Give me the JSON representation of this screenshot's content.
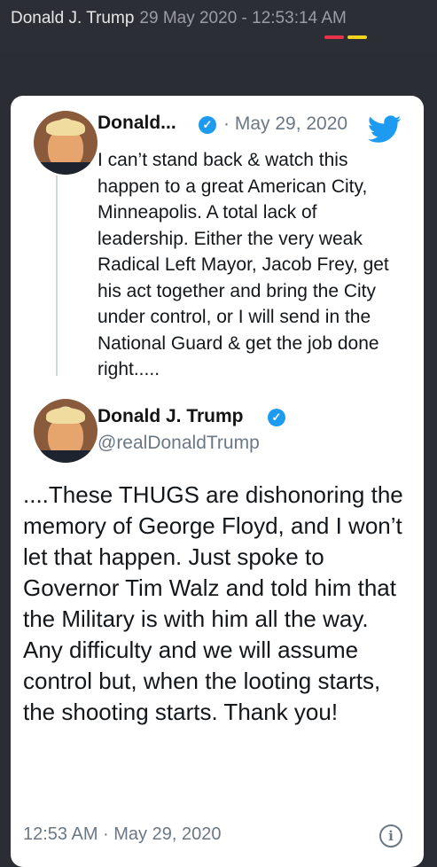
{
  "header": {
    "author": "Donald J. Trump",
    "timestamp": "29 May 2020 - 12:53:14 AM"
  },
  "quoted_tweet": {
    "name": "Donald...",
    "date": "· May 29, 2020",
    "text": "I can’t stand back & watch this happen to a great American City, Minneapolis. A total lack of leadership. Either the very weak Radical Left Mayor, Jacob Frey, get his act together and bring the City under control, or I will send in the National Guard & get the job done right....."
  },
  "main_tweet": {
    "name": "Donald J. Trump",
    "handle": "@realDonaldTrump",
    "text": "....These THUGS are dishonoring the memory of George Floyd, and I won’t let that happen. Just spoke to Governor Tim Walz and told him that the Military is with him all the way. Any difficulty and we will assume control but, when the looting starts, the shooting starts. Thank you!",
    "time": "12:53 AM · May 29, 2020"
  },
  "icons": {
    "verified": "verified-check-icon",
    "bird": "twitter-bird-icon",
    "info": "info-icon"
  },
  "colors": {
    "twitter_blue": "#1d9bf0",
    "annotation_red": "#e8334a",
    "annotation_yellow": "#f2d21c"
  }
}
